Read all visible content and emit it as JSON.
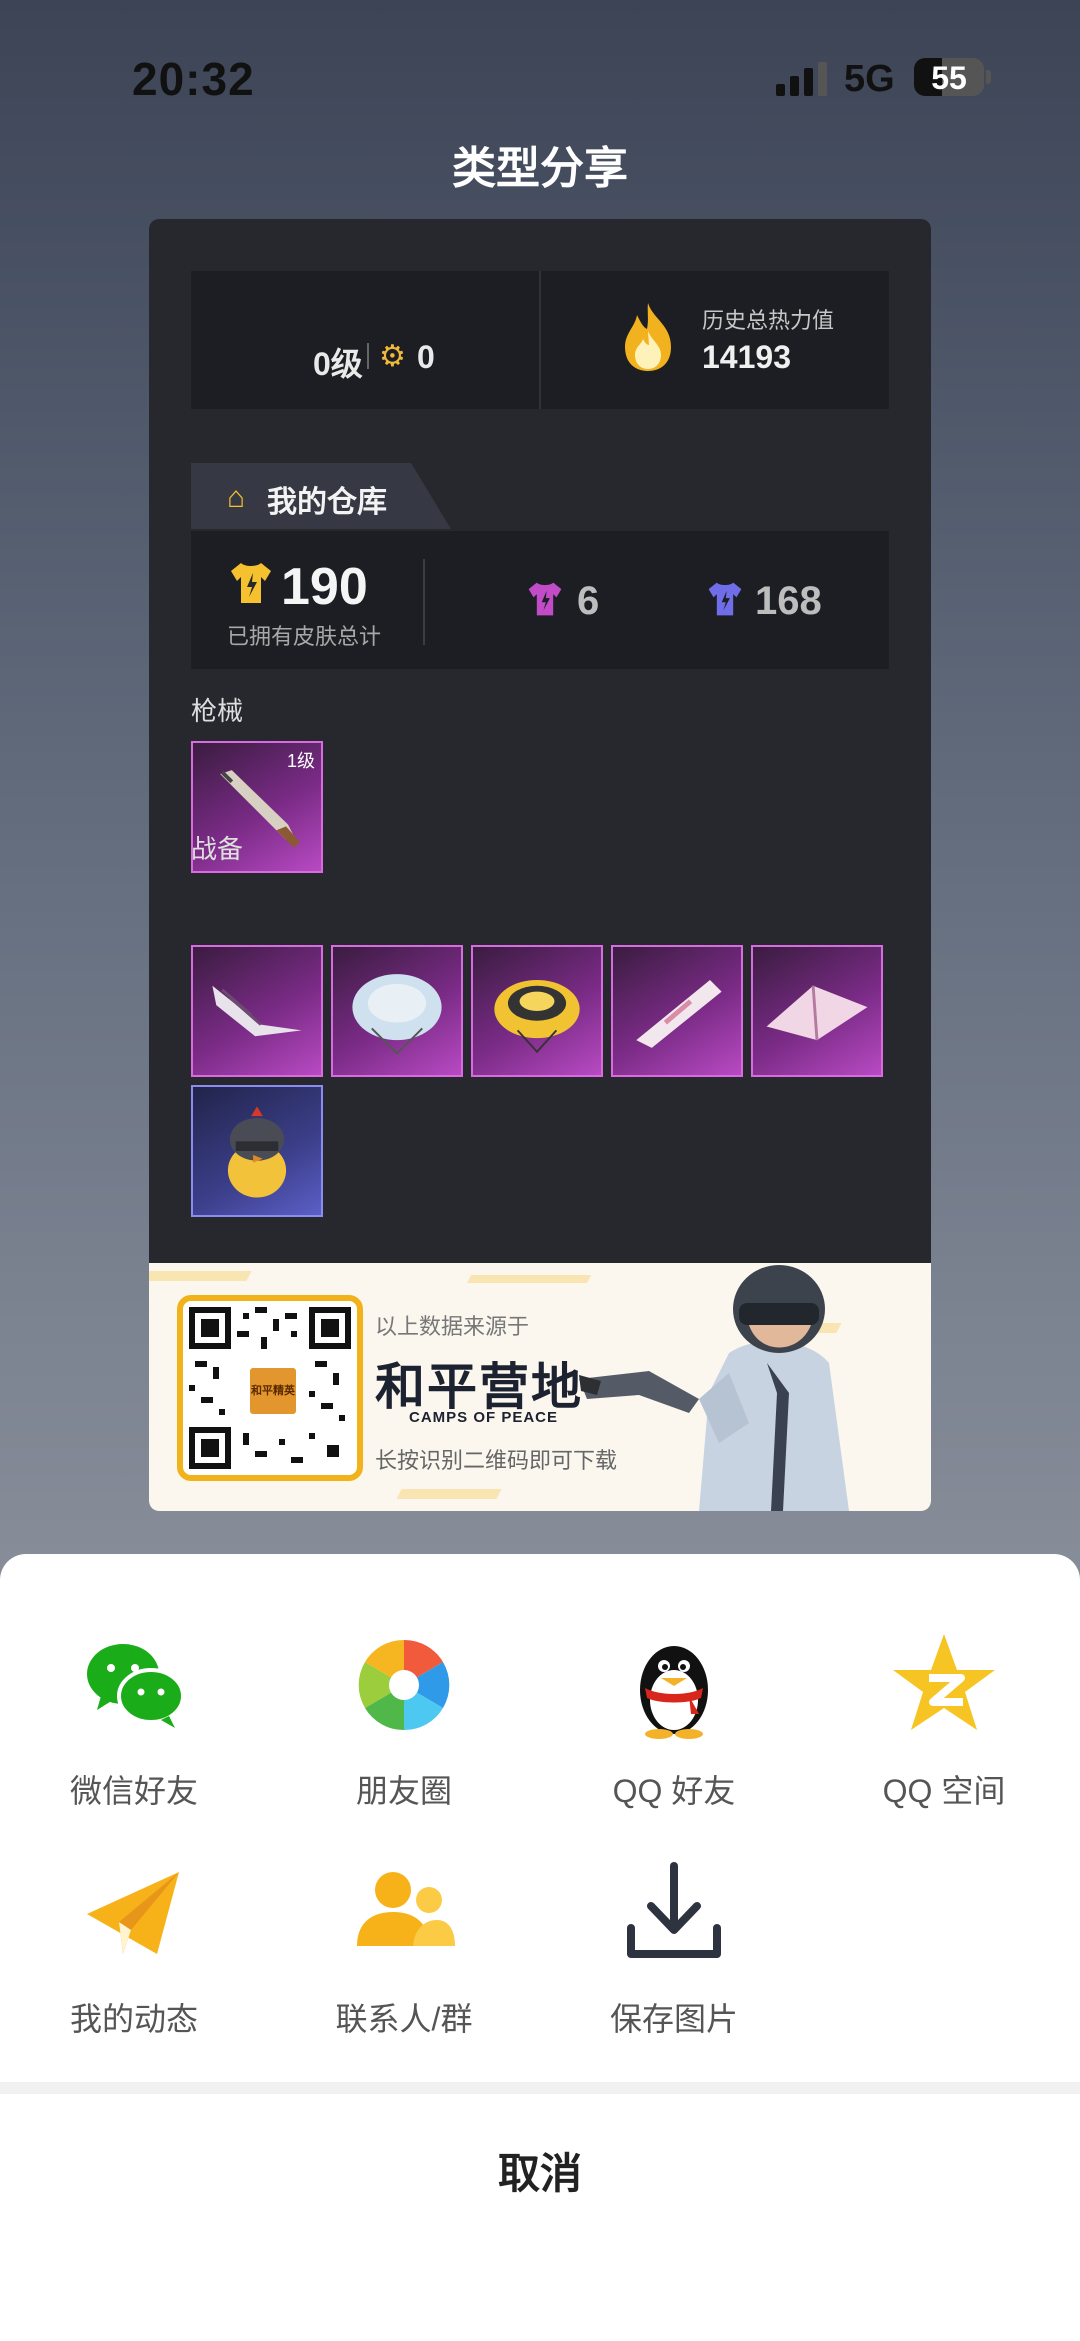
{
  "status_bar": {
    "time": "20:32",
    "network": "5G",
    "battery": "55"
  },
  "page": {
    "title": "类型分享"
  },
  "card": {
    "level": "0级",
    "badge_count": "0",
    "heat_label": "历史总热力值",
    "heat_value": "14193",
    "warehouse_title": "我的仓库",
    "skin_total": "190",
    "skin_total_label": "已拥有皮肤总计",
    "purple_skins": "6",
    "blue_skins": "168",
    "weapons_label": "枪械",
    "weapon_level": "1级",
    "gear_label": "战备"
  },
  "banner": {
    "source_text": "以上数据来源于",
    "logo_text": "和平营地",
    "logo_sub": "CAMPS OF PEACE",
    "qr_logo_text": "和平精英",
    "hint_text": "长按识别二维码即可下载"
  },
  "share": {
    "items": [
      {
        "label": "微信好友",
        "icon": "wechat-icon"
      },
      {
        "label": "朋友圈",
        "icon": "moments-icon"
      },
      {
        "label": "QQ 好友",
        "icon": "qq-icon"
      },
      {
        "label": "QQ 空间",
        "icon": "qzone-icon"
      },
      {
        "label": "我的动态",
        "icon": "paper-plane-icon"
      },
      {
        "label": "联系人/群",
        "icon": "contacts-icon"
      },
      {
        "label": "保存图片",
        "icon": "download-icon"
      }
    ],
    "cancel_label": "取消"
  },
  "colors": {
    "accent_yellow": "#f5c12e",
    "wechat_green": "#1aad19",
    "purple_item": "#b84ac3",
    "blue_item": "#5c5fc7"
  }
}
